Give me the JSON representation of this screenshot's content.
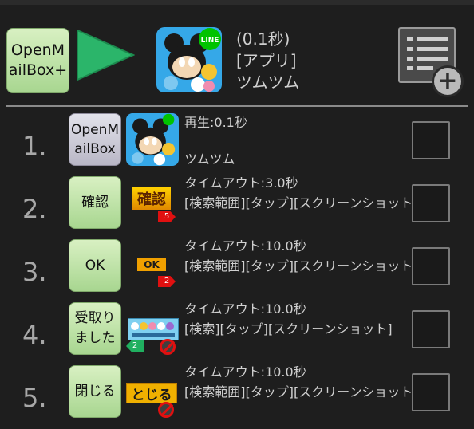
{
  "header": {
    "open_button_label": "OpenM\nailBox+",
    "app_time": "(0.1秒)",
    "app_type": "[アプリ]",
    "app_name": "ツムツム"
  },
  "rows": [
    {
      "number": "1.",
      "button_label": "OpenM\nailBox",
      "line1": "再生:0.1秒",
      "line2": "ツムツム"
    },
    {
      "number": "2.",
      "button_label": "確認",
      "thumb_text": "確認",
      "tag_number": "5",
      "line1": "タイムアウト:3.0秒",
      "line2": "[検索範囲][タップ][スクリーンショット]"
    },
    {
      "number": "3.",
      "button_label": "OK",
      "thumb_text": "OK",
      "tag_number": "2",
      "line1": "タイムアウト:10.0秒",
      "line2": "[検索範囲][タップ][スクリーンショット]"
    },
    {
      "number": "4.",
      "button_label": "受取り\nました",
      "tag_number": "2",
      "line1": "タイムアウト:10.0秒",
      "line2": "[検索][タップ][スクリーンショット]"
    },
    {
      "number": "5.",
      "button_label": "閉じる",
      "thumb_text": "とじる",
      "line1": "タイムアウト:10.0秒",
      "line2": "[検索範囲][タップ][スクリーンショット]"
    }
  ],
  "colors": {
    "background": "#1e1e1e",
    "green_button": "#a8d690",
    "play_arrow": "#2bb56a",
    "badge_orange": "#f0a000",
    "tag_red": "#e01010"
  },
  "icons": [
    "play-icon",
    "tsum-tsum-app-icon",
    "line-badge-icon",
    "list-add-icon",
    "plus-icon",
    "no-entry-icon",
    "arrow-tag-icon"
  ]
}
